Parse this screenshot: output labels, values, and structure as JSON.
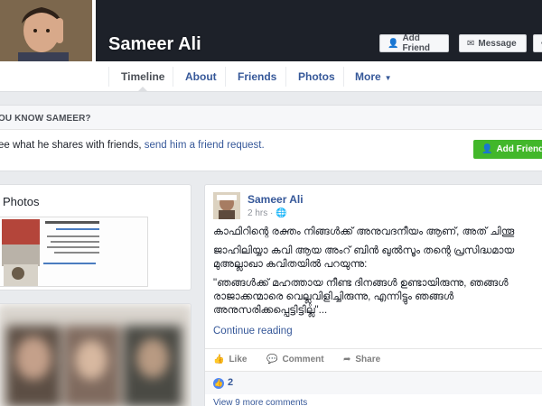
{
  "profile": {
    "name": "Sameer Ali"
  },
  "header_buttons": {
    "add_friend": "Add Friend",
    "message": "Message",
    "more": "•••"
  },
  "tabs": [
    {
      "label": "Timeline",
      "active": true
    },
    {
      "label": "About"
    },
    {
      "label": "Friends"
    },
    {
      "label": "Photos"
    },
    {
      "label": "More"
    }
  ],
  "know_box": {
    "title": "OU KNOW SAMEER?",
    "text_prefix": "ee what he shares with friends, ",
    "text_link": "send him a friend request.",
    "button": "Add Friend"
  },
  "photos_section": {
    "title": "Photos"
  },
  "post": {
    "author": "Sameer Ali",
    "time": "2 hrs",
    "privacy_icon": "globe-icon",
    "paragraphs": [
      "കാഫിറിന്റെ രക്തം നിങ്ങള്‍ക്ക് അനുവദനീയം ആണ്, അത് ചിന്തൂ",
      "ജാഹിലിയ്യാ കവി ആയ അംറ് ബിന്‍ ഖുല്‍സൂം തന്റെ പ്രസിദ്ധമായ മുഅല്ലാഖാ കവിതയില്‍ പറയുന്നു:",
      "\"ഞങ്ങള്‍ക്ക് മഹത്തായ നീണ്ട ദിനങ്ങള്‍ ഉണ്ടായിരുന്നു, ഞങ്ങള്‍ രാജാക്കന്മാരെ വെല്ലുവിളിച്ചിരുന്നു, എന്നിട്ടും ഞങ്ങള്‍ അനുസരിക്കപ്പെട്ടിട്ടില്ല\"..."
    ],
    "continue_reading": "Continue reading",
    "actions": {
      "like": "Like",
      "comment": "Comment",
      "share": "Share"
    },
    "reaction_count": "2",
    "more_comments": "View 9 more comments"
  },
  "colors": {
    "cover": "#1d2129",
    "link": "#365899",
    "green": "#42b72a",
    "background": "#e9ebee"
  }
}
